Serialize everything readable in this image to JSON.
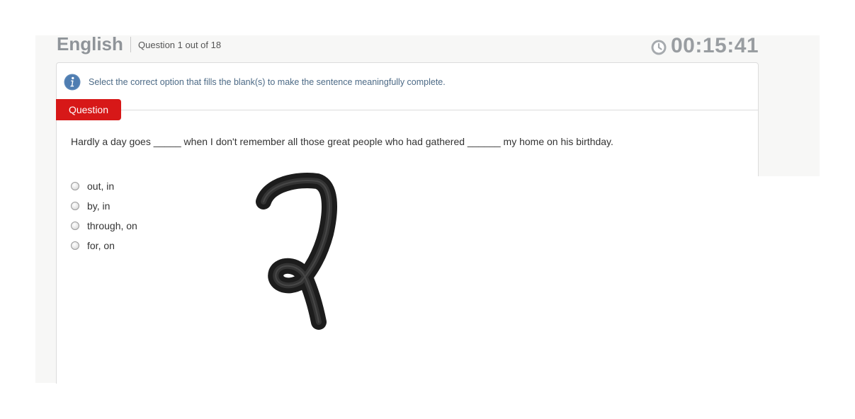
{
  "header": {
    "subject": "English",
    "question_counter": "Question 1 out of 18",
    "timer": "00:15:41"
  },
  "instruction": {
    "text": "Select the correct option that fills the blank(s) to make the sentence meaningfully complete."
  },
  "question": {
    "tab_label": "Question",
    "text": "Hardly a day goes _____ when I don't remember all those great people who had gathered ______ my home on his birthday.",
    "options": [
      {
        "label": "out, in"
      },
      {
        "label": "by, in"
      },
      {
        "label": "through, on"
      },
      {
        "label": "for, on"
      }
    ]
  },
  "colors": {
    "tab_red": "#d71818",
    "timer_gray": "#999da1",
    "info_blue": "#5b87b8"
  }
}
